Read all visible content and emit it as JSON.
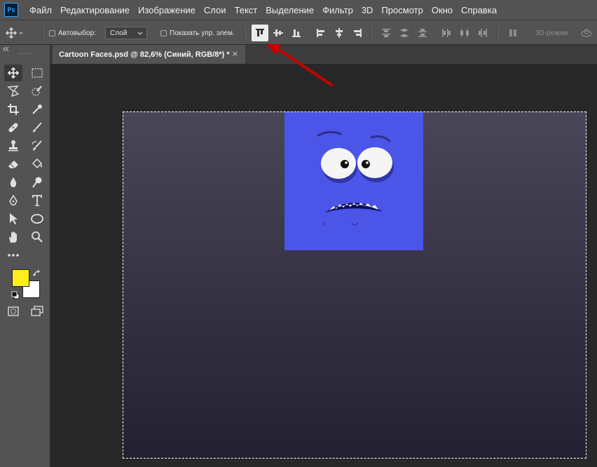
{
  "app": {
    "logo": "Ps"
  },
  "menu": [
    "Файл",
    "Редактирование",
    "Изображение",
    "Слои",
    "Текст",
    "Выделение",
    "Фильтр",
    "3D",
    "Просмотр",
    "Окно",
    "Справка"
  ],
  "options": {
    "autoselect_label": "Автовыбор:",
    "autoselect_value": "Слой",
    "show_transform_label": "Показать упр. элем.",
    "threed_label": "3D-режим:"
  },
  "document": {
    "tab_title": "Cartoon Faces.psd @ 82,6% (Синий, RGB/8*) *",
    "close_glyph": "×"
  },
  "colors": {
    "foreground": "#ffee22",
    "background": "#ffffff",
    "layer_fill": "#4b55e8",
    "annotation_arrow": "#c80000"
  },
  "icons": {
    "tools": [
      "move-icon",
      "rect-marquee-icon",
      "lasso-icon",
      "quick-select-icon",
      "crop-icon",
      "eyedropper-icon",
      "healing-icon",
      "brush-icon",
      "stamp-icon",
      "history-brush-icon",
      "eraser-icon",
      "paint-bucket-icon",
      "blur-icon",
      "dodge-icon",
      "pen-icon",
      "type-icon",
      "path-select-icon",
      "ellipse-icon",
      "hand-icon",
      "zoom-icon",
      "more-icon"
    ],
    "align": [
      "align-top-icon",
      "align-vcenter-icon",
      "align-bottom-icon",
      "align-left-icon",
      "align-hcenter-icon",
      "align-right-icon"
    ],
    "distribute": [
      "dist-top-icon",
      "dist-vcenter-icon",
      "dist-bottom-icon",
      "dist-left-icon",
      "dist-hcenter-icon",
      "dist-right-icon",
      "auto-align-icon"
    ]
  }
}
